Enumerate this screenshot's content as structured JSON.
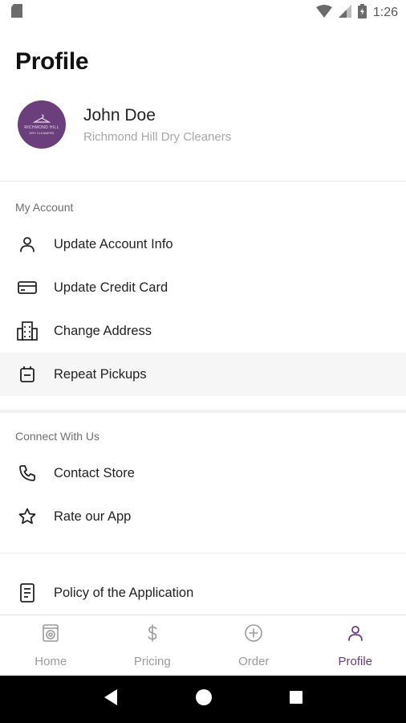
{
  "status_bar": {
    "time": "1:26",
    "left_icon": "sd-card-icon",
    "wifi_icon": "wifi-icon",
    "signal_icon": "signal-icon",
    "battery_icon": "battery-icon"
  },
  "page": {
    "title": "Profile"
  },
  "profile": {
    "name": "John Doe",
    "store": "Richmond Hill Dry Cleaners",
    "avatar_text_line1": "RICHMOND HILL",
    "avatar_text_line2": "DRY CLEANERS"
  },
  "my_account": {
    "label": "My Account",
    "items": [
      {
        "label": "Update Account Info",
        "icon": "person-icon"
      },
      {
        "label": "Update Credit Card",
        "icon": "credit-card-icon"
      },
      {
        "label": "Change Address",
        "icon": "building-icon"
      },
      {
        "label": "Repeat Pickups",
        "icon": "calendar-icon"
      }
    ]
  },
  "connect": {
    "label": "Connect With Us",
    "items": [
      {
        "label": "Contact Store",
        "icon": "phone-icon"
      },
      {
        "label": "Rate our App",
        "icon": "star-icon"
      }
    ]
  },
  "policy": {
    "label": "Policy of the Application",
    "icon": "document-icon"
  },
  "bottom_nav": [
    {
      "label": "Home",
      "icon": "home-icon",
      "active": false
    },
    {
      "label": "Pricing",
      "icon": "dollar-icon",
      "active": false
    },
    {
      "label": "Order",
      "icon": "plus-circle-icon",
      "active": false
    },
    {
      "label": "Profile",
      "icon": "person-icon",
      "active": true
    }
  ],
  "colors": {
    "accent": "#6d3a82",
    "avatar_bg": "#6b3f7c",
    "inactive": "#9a9a9a"
  }
}
